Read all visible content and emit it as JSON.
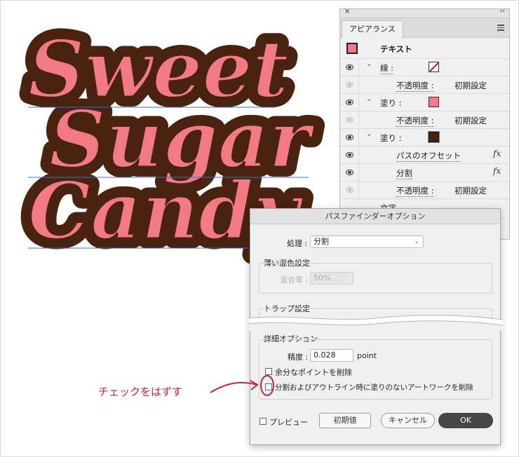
{
  "artwork": {
    "lines": [
      "Sweet",
      "Sugar",
      "Candy"
    ],
    "fill_color": "#f27a86",
    "offset_color": "#4a2210",
    "guide_color": "#3a6fd8"
  },
  "appearance_panel": {
    "close_glyph": "×",
    "collapse_glyph": "‹‹",
    "tab_label": "アピアランス",
    "menu_icon": "hamburger-menu-icon",
    "header_title": "テキスト",
    "rows": {
      "stroke_label": "線 :",
      "opacity_1_label": "不透明度 :",
      "opacity_1_value": "初期設定",
      "fill_1_label": "塗り :",
      "opacity_2_label": "不透明度 :",
      "opacity_2_value": "初期設定",
      "fill_2_label": "塗り :",
      "offset_path_label": "パスのオフセット",
      "divide_label": "分割",
      "opacity_3_label": "不透明度 :",
      "opacity_3_value": "初期設定",
      "char_label": "文字",
      "fx_glyph": "fx"
    },
    "colors": {
      "fill_swatch": "#f27a86",
      "fill2_swatch": "#4a2210",
      "stroke_none": "#d0021b"
    }
  },
  "pathfinder_dialog": {
    "title": "パスファインダーオプション",
    "operation_label": "処理 :",
    "operation_value": "分割",
    "mix_group_title": "薄い混色設定",
    "mix_rate_label": "混合率 :",
    "mix_rate_value": "50%",
    "trap_group_title": "トラップ設定",
    "detail_group_title": "詳細オプション",
    "precision_label": "精度 :",
    "precision_value": "0.028",
    "precision_unit": "point",
    "remove_redundant_label": "余分なポイントを削除",
    "remove_redundant_checked": false,
    "remove_unpainted_label": "分割およびアウトライン時に塗りのないアートワークを削除",
    "remove_unpainted_checked": false,
    "preview_label": "プレビュー",
    "preview_checked": false,
    "defaults_button": "初期値",
    "cancel_button": "キャンセル",
    "ok_button": "OK"
  },
  "annotation": {
    "text": "チェックをはずす",
    "color": "#c0253a"
  }
}
